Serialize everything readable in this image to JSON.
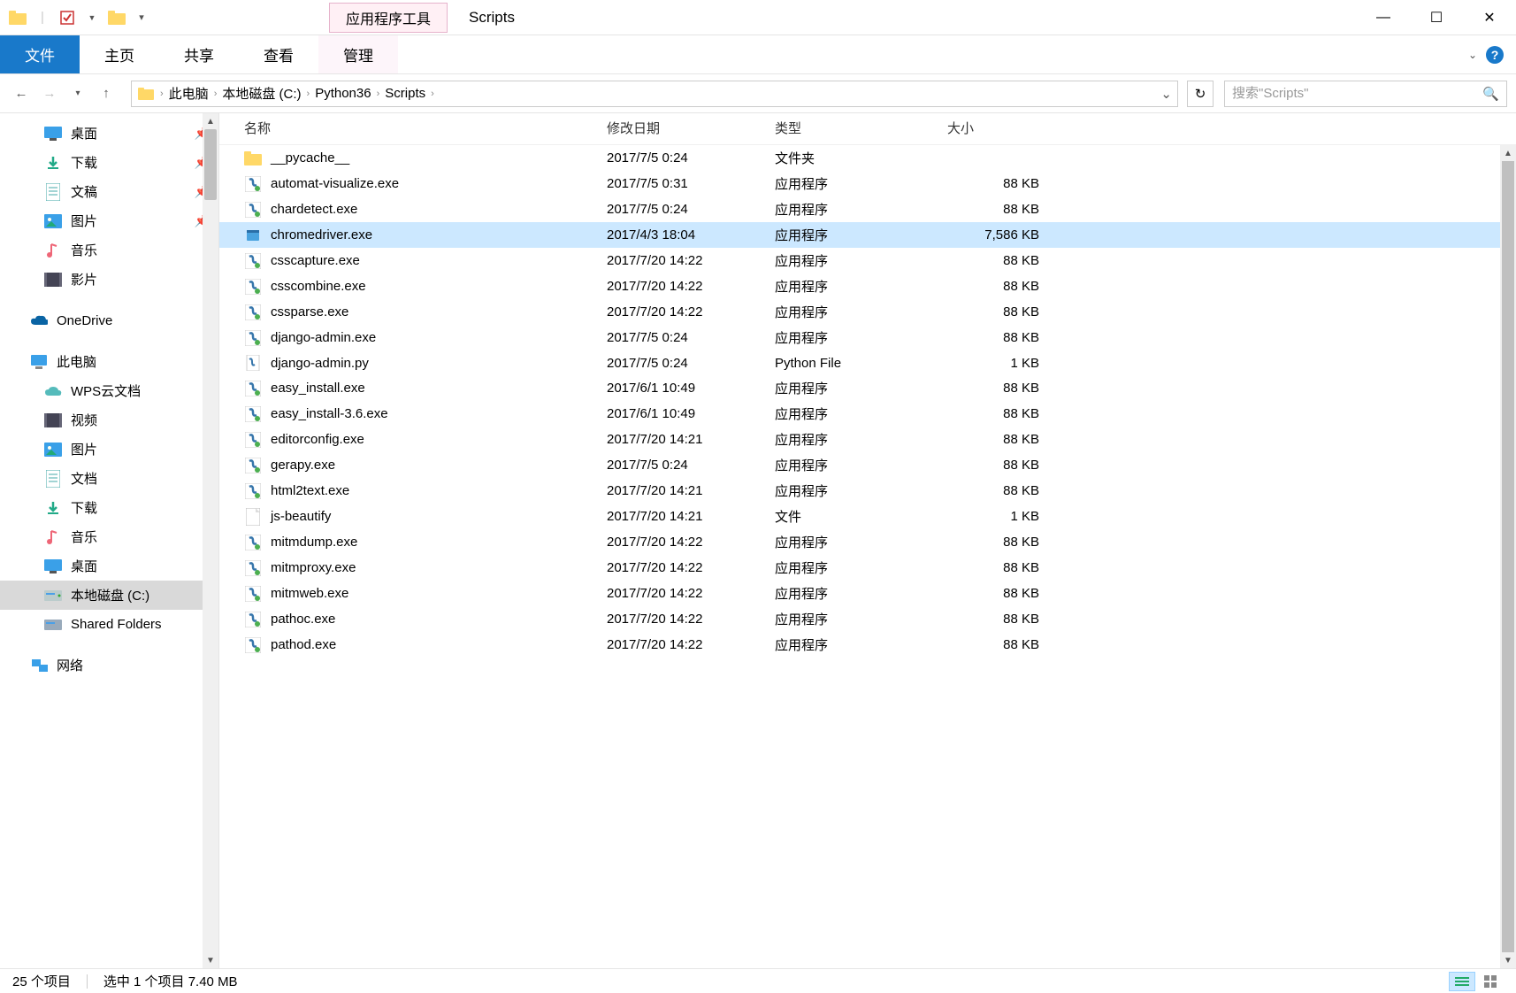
{
  "window": {
    "context_tab": "应用程序工具",
    "title": "Scripts"
  },
  "ribbon": {
    "tabs": [
      "文件",
      "主页",
      "共享",
      "查看",
      "管理"
    ],
    "active_index": 0,
    "ctx_index": 4
  },
  "nav": {
    "breadcrumbs": [
      "此电脑",
      "本地磁盘 (C:)",
      "Python36",
      "Scripts"
    ],
    "search_placeholder": "搜索\"Scripts\""
  },
  "columns": {
    "name": "名称",
    "date": "修改日期",
    "type": "类型",
    "size": "大小"
  },
  "sidebar": [
    {
      "label": "桌面",
      "icon": "desktop",
      "pin": true,
      "lvl": 1
    },
    {
      "label": "下载",
      "icon": "download",
      "pin": true,
      "lvl": 1
    },
    {
      "label": "文稿",
      "icon": "document",
      "pin": true,
      "lvl": 1
    },
    {
      "label": "图片",
      "icon": "picture",
      "pin": true,
      "lvl": 1
    },
    {
      "label": "音乐",
      "icon": "music",
      "pin": false,
      "lvl": 1
    },
    {
      "label": "影片",
      "icon": "video",
      "pin": false,
      "lvl": 1
    },
    {
      "label": "",
      "spacer": true
    },
    {
      "label": "OneDrive",
      "icon": "cloud",
      "pin": false,
      "lvl": 0
    },
    {
      "label": "",
      "spacer": true
    },
    {
      "label": "此电脑",
      "icon": "pc",
      "pin": false,
      "lvl": 0
    },
    {
      "label": "WPS云文档",
      "icon": "wpscloud",
      "pin": false,
      "lvl": 1
    },
    {
      "label": "视频",
      "icon": "video2",
      "pin": false,
      "lvl": 1
    },
    {
      "label": "图片",
      "icon": "picture",
      "pin": false,
      "lvl": 1
    },
    {
      "label": "文档",
      "icon": "document",
      "pin": false,
      "lvl": 1
    },
    {
      "label": "下载",
      "icon": "download",
      "pin": false,
      "lvl": 1
    },
    {
      "label": "音乐",
      "icon": "music",
      "pin": false,
      "lvl": 1
    },
    {
      "label": "桌面",
      "icon": "desktop",
      "pin": false,
      "lvl": 1
    },
    {
      "label": "本地磁盘 (C:)",
      "icon": "drive",
      "pin": false,
      "lvl": 1,
      "selected": true
    },
    {
      "label": "Shared Folders",
      "icon": "sharedrive",
      "pin": false,
      "lvl": 1
    },
    {
      "label": "",
      "spacer": true
    },
    {
      "label": "网络",
      "icon": "network",
      "pin": false,
      "lvl": 0
    }
  ],
  "files": [
    {
      "name": "__pycache__",
      "date": "2017/7/5 0:24",
      "type": "文件夹",
      "size": "",
      "icon": "folder"
    },
    {
      "name": "automat-visualize.exe",
      "date": "2017/7/5 0:31",
      "type": "应用程序",
      "size": "88 KB",
      "icon": "pyexe"
    },
    {
      "name": "chardetect.exe",
      "date": "2017/7/5 0:24",
      "type": "应用程序",
      "size": "88 KB",
      "icon": "pyexe"
    },
    {
      "name": "chromedriver.exe",
      "date": "2017/4/3 18:04",
      "type": "应用程序",
      "size": "7,586 KB",
      "icon": "exe",
      "selected": true
    },
    {
      "name": "csscapture.exe",
      "date": "2017/7/20 14:22",
      "type": "应用程序",
      "size": "88 KB",
      "icon": "pyexe"
    },
    {
      "name": "csscombine.exe",
      "date": "2017/7/20 14:22",
      "type": "应用程序",
      "size": "88 KB",
      "icon": "pyexe"
    },
    {
      "name": "cssparse.exe",
      "date": "2017/7/20 14:22",
      "type": "应用程序",
      "size": "88 KB",
      "icon": "pyexe"
    },
    {
      "name": "django-admin.exe",
      "date": "2017/7/5 0:24",
      "type": "应用程序",
      "size": "88 KB",
      "icon": "pyexe"
    },
    {
      "name": "django-admin.py",
      "date": "2017/7/5 0:24",
      "type": "Python File",
      "size": "1 KB",
      "icon": "pyfile"
    },
    {
      "name": "easy_install.exe",
      "date": "2017/6/1 10:49",
      "type": "应用程序",
      "size": "88 KB",
      "icon": "pyexe"
    },
    {
      "name": "easy_install-3.6.exe",
      "date": "2017/6/1 10:49",
      "type": "应用程序",
      "size": "88 KB",
      "icon": "pyexe"
    },
    {
      "name": "editorconfig.exe",
      "date": "2017/7/20 14:21",
      "type": "应用程序",
      "size": "88 KB",
      "icon": "pyexe"
    },
    {
      "name": "gerapy.exe",
      "date": "2017/7/5 0:24",
      "type": "应用程序",
      "size": "88 KB",
      "icon": "pyexe"
    },
    {
      "name": "html2text.exe",
      "date": "2017/7/20 14:21",
      "type": "应用程序",
      "size": "88 KB",
      "icon": "pyexe"
    },
    {
      "name": "js-beautify",
      "date": "2017/7/20 14:21",
      "type": "文件",
      "size": "1 KB",
      "icon": "file"
    },
    {
      "name": "mitmdump.exe",
      "date": "2017/7/20 14:22",
      "type": "应用程序",
      "size": "88 KB",
      "icon": "pyexe"
    },
    {
      "name": "mitmproxy.exe",
      "date": "2017/7/20 14:22",
      "type": "应用程序",
      "size": "88 KB",
      "icon": "pyexe"
    },
    {
      "name": "mitmweb.exe",
      "date": "2017/7/20 14:22",
      "type": "应用程序",
      "size": "88 KB",
      "icon": "pyexe"
    },
    {
      "name": "pathoc.exe",
      "date": "2017/7/20 14:22",
      "type": "应用程序",
      "size": "88 KB",
      "icon": "pyexe"
    },
    {
      "name": "pathod.exe",
      "date": "2017/7/20 14:22",
      "type": "应用程序",
      "size": "88 KB",
      "icon": "pyexe"
    }
  ],
  "status": {
    "count": "25 个项目",
    "selected": "选中 1 个项目 7.40 MB"
  }
}
